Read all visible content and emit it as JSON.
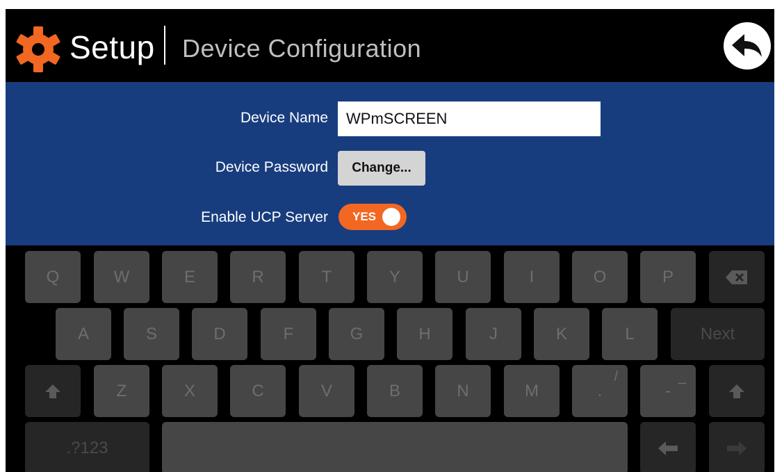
{
  "header": {
    "title": "Setup",
    "subtitle": "Device Configuration",
    "icons": {
      "settings": "gear-icon",
      "back": "back-arrow-icon"
    },
    "accent_color": "#f26722"
  },
  "form": {
    "device_name_label": "Device Name",
    "device_name_value": "WPmSCREEN",
    "device_password_label": "Device Password",
    "change_button_label": "Change...",
    "ucp_label": "Enable UCP Server",
    "ucp_toggle_text": "YES",
    "ucp_enabled": true,
    "panel_color": "#173d7e"
  },
  "keyboard": {
    "row1": [
      "Q",
      "W",
      "E",
      "R",
      "T",
      "Y",
      "U",
      "I",
      "O",
      "P"
    ],
    "row2": [
      "A",
      "S",
      "D",
      "F",
      "G",
      "H",
      "J",
      "K",
      "L"
    ],
    "next_label": "Next",
    "row3": [
      "Z",
      "X",
      "C",
      "V",
      "B",
      "N",
      "M"
    ],
    "period_key": {
      "main": ".",
      "alt": "/"
    },
    "dash_key": {
      "main": "-",
      "alt": "_"
    },
    "symbols_label": ".?123",
    "icons": [
      "backspace-icon",
      "shift-icon",
      "left-arrow-icon",
      "right-arrow-icon"
    ]
  }
}
